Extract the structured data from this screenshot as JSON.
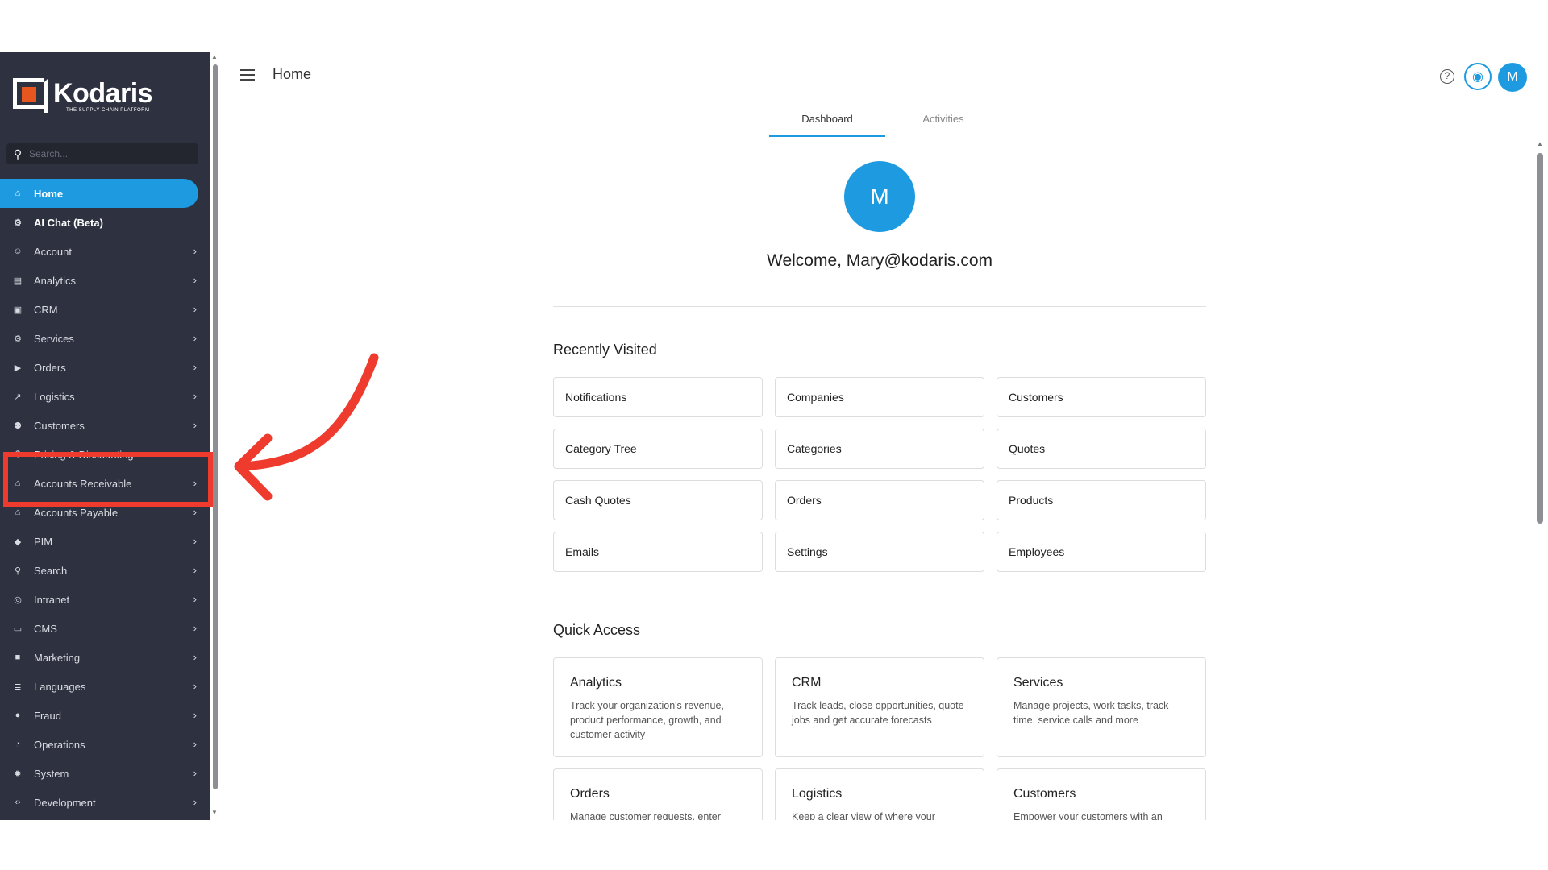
{
  "sidebar": {
    "logo_text": "Kodaris",
    "logo_subtitle": "THE SUPPLY CHAIN PLATFORM",
    "search_placeholder": "Search...",
    "items": [
      {
        "label": "Home",
        "icon": "home-icon",
        "state": "active",
        "chevron": false
      },
      {
        "label": "AI Chat (Beta)",
        "icon": "robot-icon",
        "state": "bold",
        "chevron": false
      },
      {
        "label": "Account",
        "icon": "user-icon",
        "state": "",
        "chevron": true
      },
      {
        "label": "Analytics",
        "icon": "chart-icon",
        "state": "",
        "chevron": true
      },
      {
        "label": "CRM",
        "icon": "contact-icon",
        "state": "",
        "chevron": true
      },
      {
        "label": "Services",
        "icon": "gears-icon",
        "state": "",
        "chevron": true
      },
      {
        "label": "Orders",
        "icon": "truck-icon",
        "state": "",
        "chevron": true
      },
      {
        "label": "Logistics",
        "icon": "route-icon",
        "state": "",
        "chevron": true
      },
      {
        "label": "Customers",
        "icon": "people-icon",
        "state": "",
        "chevron": true
      },
      {
        "label": "Pricing & Discounting",
        "icon": "dollar-icon",
        "state": "",
        "chevron": true
      },
      {
        "label": "Accounts Receivable",
        "icon": "bank-icon",
        "state": "",
        "chevron": true
      },
      {
        "label": "Accounts Payable",
        "icon": "bank-icon",
        "state": "",
        "chevron": true
      },
      {
        "label": "PIM",
        "icon": "tag-icon",
        "state": "",
        "chevron": true
      },
      {
        "label": "Search",
        "icon": "search-icon",
        "state": "",
        "chevron": true
      },
      {
        "label": "Intranet",
        "icon": "globe-icon",
        "state": "",
        "chevron": true
      },
      {
        "label": "CMS",
        "icon": "window-icon",
        "state": "",
        "chevron": true
      },
      {
        "label": "Marketing",
        "icon": "ad-icon",
        "state": "",
        "chevron": true
      },
      {
        "label": "Languages",
        "icon": "translate-icon",
        "state": "",
        "chevron": true
      },
      {
        "label": "Fraud",
        "icon": "shield-icon",
        "state": "",
        "chevron": true
      },
      {
        "label": "Operations",
        "icon": "pie-icon",
        "state": "",
        "chevron": true
      },
      {
        "label": "System",
        "icon": "gear-icon",
        "state": "",
        "chevron": true
      },
      {
        "label": "Development",
        "icon": "code-icon",
        "state": "",
        "chevron": true
      }
    ]
  },
  "header": {
    "title": "Home",
    "avatar_letter": "M",
    "help_glyph": "?"
  },
  "tabs": [
    {
      "label": "Dashboard",
      "active": true
    },
    {
      "label": "Activities",
      "active": false
    }
  ],
  "main": {
    "avatar_letter": "M",
    "welcome": "Welcome, Mary@kodaris.com",
    "recently_visited_title": "Recently Visited",
    "recently_visited": [
      "Notifications",
      "Companies",
      "Customers",
      "Category Tree",
      "Categories",
      "Quotes",
      "Cash Quotes",
      "Orders",
      "Products",
      "Emails",
      "Settings",
      "Employees"
    ],
    "quick_access_title": "Quick Access",
    "quick_access": [
      {
        "title": "Analytics",
        "desc": "Track your organization's revenue, product performance, growth, and customer activity"
      },
      {
        "title": "CRM",
        "desc": "Track leads, close opportunities, quote jobs and get accurate forecasts"
      },
      {
        "title": "Services",
        "desc": "Manage projects, work tasks, track time, service calls and more"
      },
      {
        "title": "Orders",
        "desc": "Manage customer requests, enter"
      },
      {
        "title": "Logistics",
        "desc": "Keep a clear view of where your"
      },
      {
        "title": "Customers",
        "desc": "Empower your customers with an"
      }
    ]
  },
  "colors": {
    "sidebar_bg": "#2e3240",
    "accent": "#1e9be0",
    "highlight": "#ef3b2d",
    "brand_orange": "#e8561f"
  }
}
